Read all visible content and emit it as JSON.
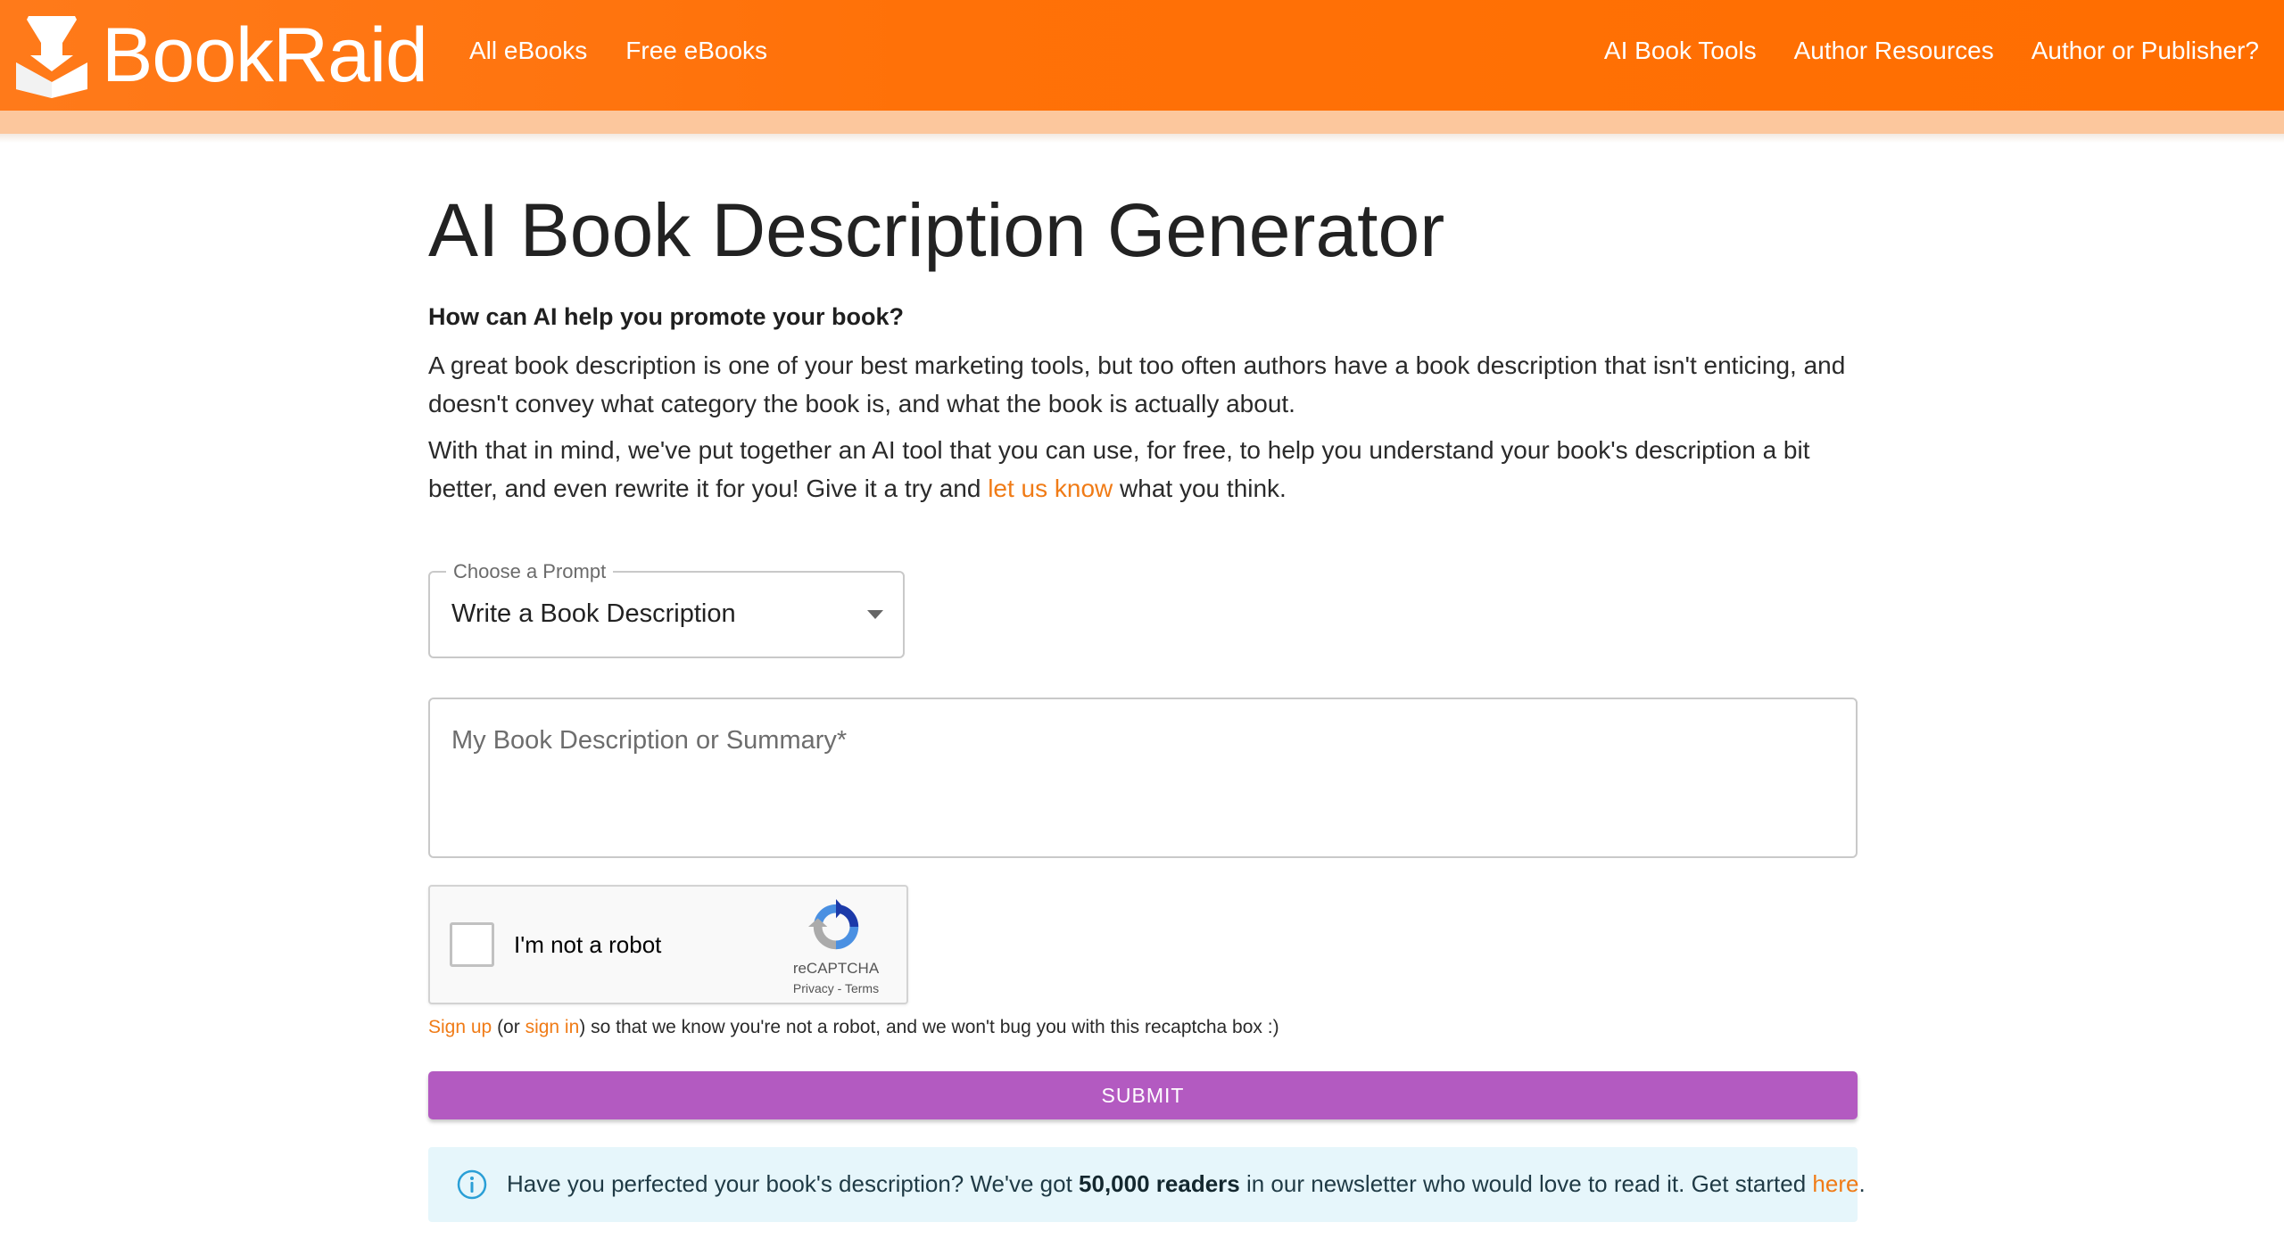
{
  "header": {
    "logo_text": "BookRaid",
    "nav_left": [
      {
        "label": "All eBooks"
      },
      {
        "label": "Free eBooks"
      }
    ],
    "nav_right": [
      {
        "label": "AI Book Tools"
      },
      {
        "label": "Author Resources"
      },
      {
        "label": "Author or Publisher?"
      }
    ]
  },
  "main": {
    "title": "AI Book Description Generator",
    "subhead": "How can AI help you promote your book?",
    "paragraph1": "A great book description is one of your best marketing tools, but too often authors have a book description that isn't enticing, and doesn't convey what category the book is, and what the book is actually about.",
    "paragraph2_before": "With that in mind, we've put together an AI tool that you can use, for free, to help you understand your book's description a bit better, and even rewrite it for you! Give it a try and ",
    "paragraph2_link": "let us know",
    "paragraph2_after": " what you think."
  },
  "prompt_select": {
    "label": "Choose a Prompt",
    "value": "Write a Book Description"
  },
  "description_field": {
    "placeholder": "My Book Description or Summary*",
    "value": ""
  },
  "captcha": {
    "label": "I'm not a robot",
    "brand": "reCAPTCHA",
    "privacy": "Privacy",
    "separator": " - ",
    "terms": "Terms"
  },
  "signup_note": {
    "signup_link": "Sign up",
    "mid1": " (or ",
    "signin_link": "sign in",
    "rest": ") so that we know you're not a robot, and we won't bug you with this recaptcha box :)"
  },
  "submit_label": "SUBMIT",
  "info_alert": {
    "text_before": "Have you perfected your book's description? We've got ",
    "bold": "50,000 readers",
    "text_after": " in our newsletter who would love to read it. Get started ",
    "link": "here",
    "end": "."
  },
  "colors": {
    "header_orange": "#ff7108",
    "link_orange": "#f07b16",
    "submit_purple": "#b35ac1",
    "info_bg": "#e6f6fb",
    "info_icon": "#2a9fd6"
  }
}
